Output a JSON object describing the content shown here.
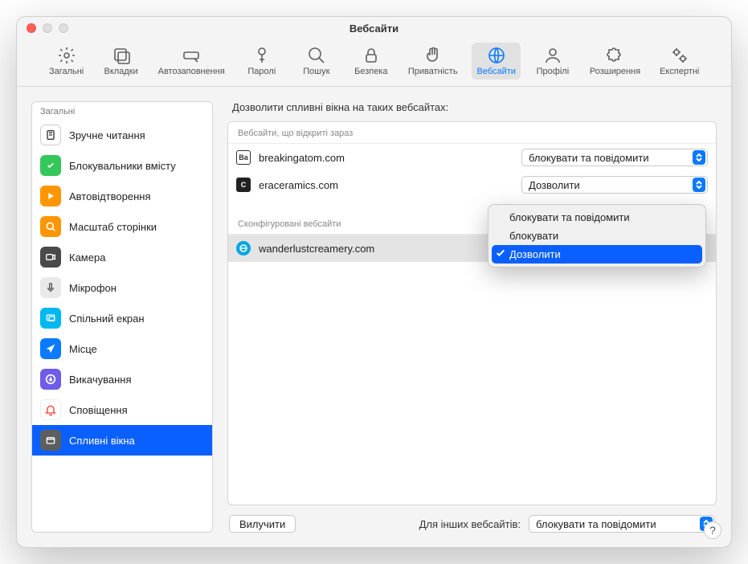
{
  "window": {
    "title": "Вебсайти"
  },
  "toolbar": {
    "items": [
      {
        "name": "general",
        "label": "Загальні"
      },
      {
        "name": "tabs",
        "label": "Вкладки"
      },
      {
        "name": "autofill",
        "label": "Автозаповнення"
      },
      {
        "name": "passwords",
        "label": "Паролі"
      },
      {
        "name": "search",
        "label": "Пошук"
      },
      {
        "name": "security",
        "label": "Безпека"
      },
      {
        "name": "privacy",
        "label": "Приватність"
      },
      {
        "name": "websites",
        "label": "Вебсайти",
        "selected": true
      },
      {
        "name": "profiles",
        "label": "Профілі"
      },
      {
        "name": "extensions",
        "label": "Розширення"
      },
      {
        "name": "advanced",
        "label": "Експертні"
      }
    ]
  },
  "sidebar": {
    "header": "Загальні",
    "items": [
      {
        "label": "Зручне читання"
      },
      {
        "label": "Блокувальники вмісту"
      },
      {
        "label": "Автовідтворення"
      },
      {
        "label": "Масштаб сторінки"
      },
      {
        "label": "Камера"
      },
      {
        "label": "Мікрофон"
      },
      {
        "label": "Спільний екран"
      },
      {
        "label": "Місце"
      },
      {
        "label": "Викачування"
      },
      {
        "label": "Сповіщення"
      },
      {
        "label": "Спливні вікна",
        "selected": true
      }
    ]
  },
  "main": {
    "title": "Дозволити спливні вікна на таких вебсайтах:",
    "group_open": "Вебсайти, що відкриті зараз",
    "group_conf": "Сконфігуровані вебсайти",
    "sites_open": [
      {
        "domain": "breakingatom.com",
        "value": "блокувати та повідомити",
        "favicon_text": "Ba",
        "favicon_bg": "#ffffff",
        "favicon_border": "#222"
      },
      {
        "domain": "eraceramics.com",
        "value": "Дозволити",
        "favicon_text": "C",
        "favicon_bg": "#222",
        "favicon_color": "#fff"
      }
    ],
    "sites_conf": [
      {
        "domain": "wanderlustcreamery.com",
        "selected": true
      }
    ]
  },
  "dropdown": {
    "items": [
      {
        "label": "блокувати та повідомити"
      },
      {
        "label": "блокувати"
      },
      {
        "label": "Дозволити",
        "active": true,
        "checked": true
      }
    ]
  },
  "bottom": {
    "remove": "Вилучити",
    "other_label": "Для інших вебсайтів:",
    "other_value": "блокувати та повідомити"
  },
  "help": "?"
}
